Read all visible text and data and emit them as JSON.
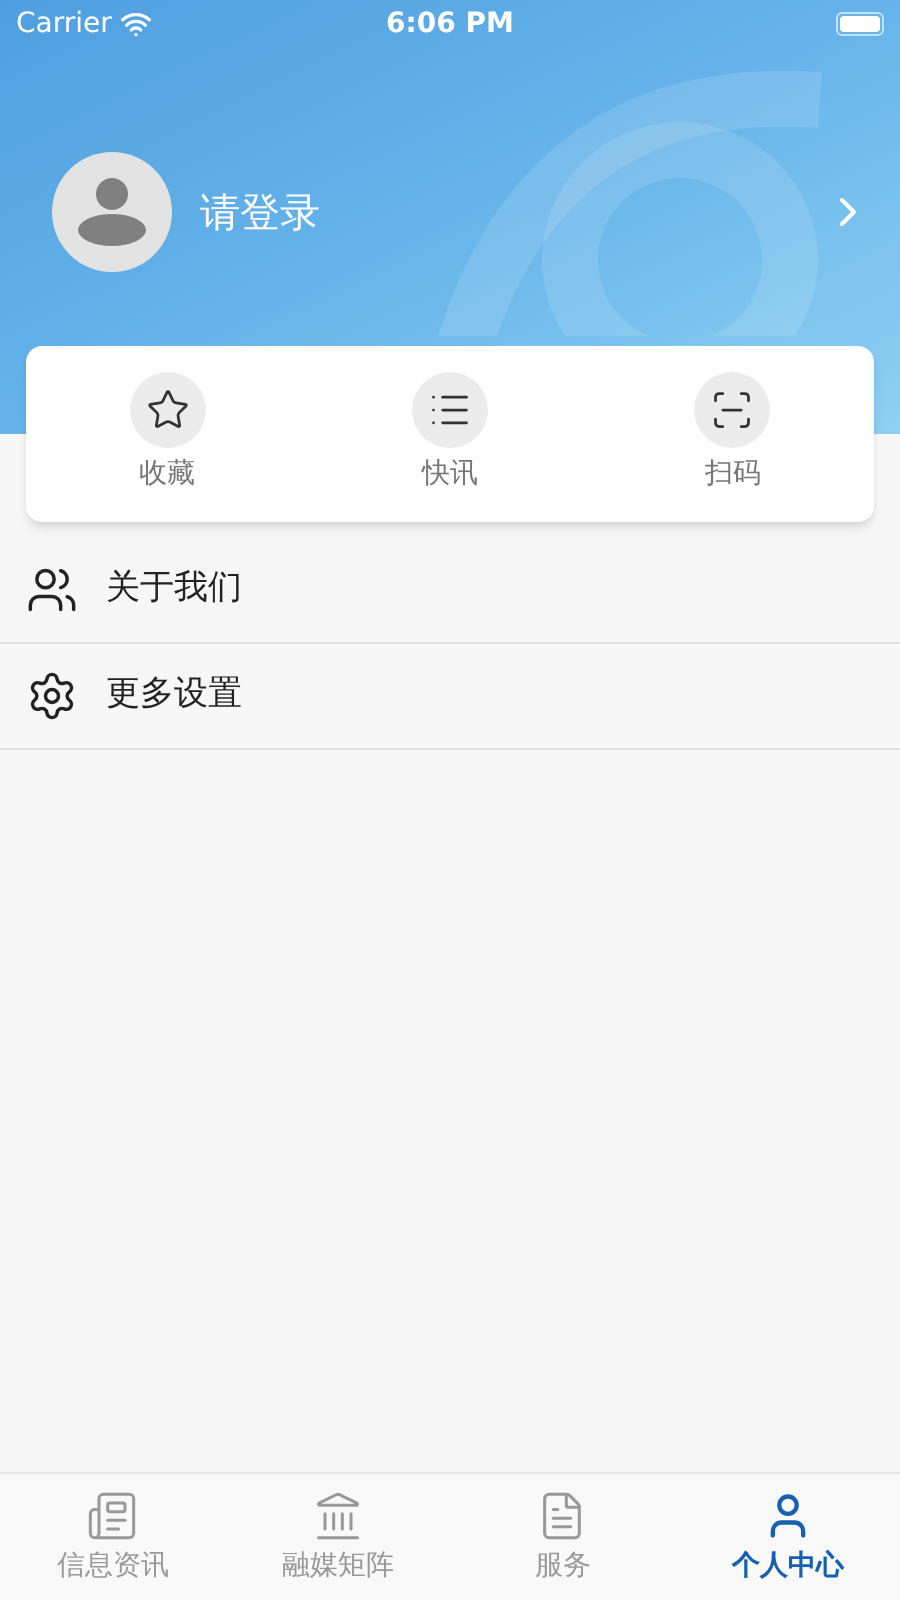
{
  "status_bar": {
    "carrier": "Carrier",
    "time": "6:06 PM"
  },
  "profile": {
    "login_prompt": "请登录"
  },
  "quick_actions": [
    {
      "kind": "star",
      "label": "收藏"
    },
    {
      "kind": "list",
      "label": "快讯"
    },
    {
      "kind": "scan",
      "label": "扫码"
    }
  ],
  "menu": [
    {
      "kind": "about",
      "label": "关于我们"
    },
    {
      "kind": "settings",
      "label": "更多设置"
    }
  ],
  "tab_bar": [
    {
      "kind": "news",
      "label": "信息资讯",
      "selected": false
    },
    {
      "kind": "media",
      "label": "融媒矩阵",
      "selected": false
    },
    {
      "kind": "service",
      "label": "服务",
      "selected": false
    },
    {
      "kind": "profile",
      "label": "个人中心",
      "selected": true
    }
  ]
}
